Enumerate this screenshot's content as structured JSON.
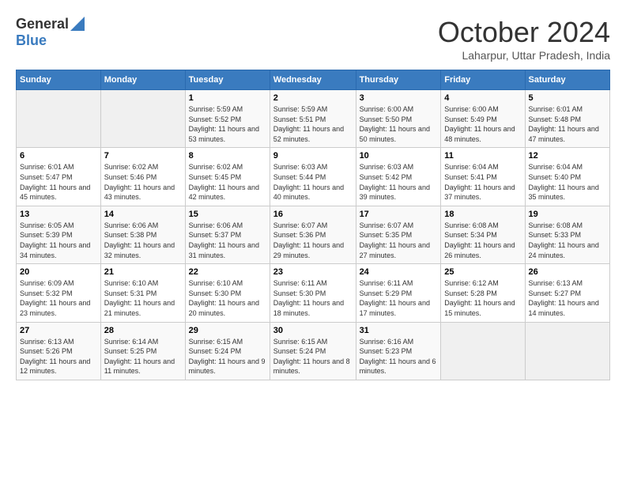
{
  "header": {
    "logo_general": "General",
    "logo_blue": "Blue",
    "month_title": "October 2024",
    "subtitle": "Laharpur, Uttar Pradesh, India"
  },
  "days_of_week": [
    "Sunday",
    "Monday",
    "Tuesday",
    "Wednesday",
    "Thursday",
    "Friday",
    "Saturday"
  ],
  "weeks": [
    [
      {
        "day": "",
        "sunrise": "",
        "sunset": "",
        "daylight": "",
        "empty": true
      },
      {
        "day": "",
        "sunrise": "",
        "sunset": "",
        "daylight": "",
        "empty": true
      },
      {
        "day": "1",
        "sunrise": "Sunrise: 5:59 AM",
        "sunset": "Sunset: 5:52 PM",
        "daylight": "Daylight: 11 hours and 53 minutes.",
        "empty": false
      },
      {
        "day": "2",
        "sunrise": "Sunrise: 5:59 AM",
        "sunset": "Sunset: 5:51 PM",
        "daylight": "Daylight: 11 hours and 52 minutes.",
        "empty": false
      },
      {
        "day": "3",
        "sunrise": "Sunrise: 6:00 AM",
        "sunset": "Sunset: 5:50 PM",
        "daylight": "Daylight: 11 hours and 50 minutes.",
        "empty": false
      },
      {
        "day": "4",
        "sunrise": "Sunrise: 6:00 AM",
        "sunset": "Sunset: 5:49 PM",
        "daylight": "Daylight: 11 hours and 48 minutes.",
        "empty": false
      },
      {
        "day": "5",
        "sunrise": "Sunrise: 6:01 AM",
        "sunset": "Sunset: 5:48 PM",
        "daylight": "Daylight: 11 hours and 47 minutes.",
        "empty": false
      }
    ],
    [
      {
        "day": "6",
        "sunrise": "Sunrise: 6:01 AM",
        "sunset": "Sunset: 5:47 PM",
        "daylight": "Daylight: 11 hours and 45 minutes.",
        "empty": false
      },
      {
        "day": "7",
        "sunrise": "Sunrise: 6:02 AM",
        "sunset": "Sunset: 5:46 PM",
        "daylight": "Daylight: 11 hours and 43 minutes.",
        "empty": false
      },
      {
        "day": "8",
        "sunrise": "Sunrise: 6:02 AM",
        "sunset": "Sunset: 5:45 PM",
        "daylight": "Daylight: 11 hours and 42 minutes.",
        "empty": false
      },
      {
        "day": "9",
        "sunrise": "Sunrise: 6:03 AM",
        "sunset": "Sunset: 5:44 PM",
        "daylight": "Daylight: 11 hours and 40 minutes.",
        "empty": false
      },
      {
        "day": "10",
        "sunrise": "Sunrise: 6:03 AM",
        "sunset": "Sunset: 5:42 PM",
        "daylight": "Daylight: 11 hours and 39 minutes.",
        "empty": false
      },
      {
        "day": "11",
        "sunrise": "Sunrise: 6:04 AM",
        "sunset": "Sunset: 5:41 PM",
        "daylight": "Daylight: 11 hours and 37 minutes.",
        "empty": false
      },
      {
        "day": "12",
        "sunrise": "Sunrise: 6:04 AM",
        "sunset": "Sunset: 5:40 PM",
        "daylight": "Daylight: 11 hours and 35 minutes.",
        "empty": false
      }
    ],
    [
      {
        "day": "13",
        "sunrise": "Sunrise: 6:05 AM",
        "sunset": "Sunset: 5:39 PM",
        "daylight": "Daylight: 11 hours and 34 minutes.",
        "empty": false
      },
      {
        "day": "14",
        "sunrise": "Sunrise: 6:06 AM",
        "sunset": "Sunset: 5:38 PM",
        "daylight": "Daylight: 11 hours and 32 minutes.",
        "empty": false
      },
      {
        "day": "15",
        "sunrise": "Sunrise: 6:06 AM",
        "sunset": "Sunset: 5:37 PM",
        "daylight": "Daylight: 11 hours and 31 minutes.",
        "empty": false
      },
      {
        "day": "16",
        "sunrise": "Sunrise: 6:07 AM",
        "sunset": "Sunset: 5:36 PM",
        "daylight": "Daylight: 11 hours and 29 minutes.",
        "empty": false
      },
      {
        "day": "17",
        "sunrise": "Sunrise: 6:07 AM",
        "sunset": "Sunset: 5:35 PM",
        "daylight": "Daylight: 11 hours and 27 minutes.",
        "empty": false
      },
      {
        "day": "18",
        "sunrise": "Sunrise: 6:08 AM",
        "sunset": "Sunset: 5:34 PM",
        "daylight": "Daylight: 11 hours and 26 minutes.",
        "empty": false
      },
      {
        "day": "19",
        "sunrise": "Sunrise: 6:08 AM",
        "sunset": "Sunset: 5:33 PM",
        "daylight": "Daylight: 11 hours and 24 minutes.",
        "empty": false
      }
    ],
    [
      {
        "day": "20",
        "sunrise": "Sunrise: 6:09 AM",
        "sunset": "Sunset: 5:32 PM",
        "daylight": "Daylight: 11 hours and 23 minutes.",
        "empty": false
      },
      {
        "day": "21",
        "sunrise": "Sunrise: 6:10 AM",
        "sunset": "Sunset: 5:31 PM",
        "daylight": "Daylight: 11 hours and 21 minutes.",
        "empty": false
      },
      {
        "day": "22",
        "sunrise": "Sunrise: 6:10 AM",
        "sunset": "Sunset: 5:30 PM",
        "daylight": "Daylight: 11 hours and 20 minutes.",
        "empty": false
      },
      {
        "day": "23",
        "sunrise": "Sunrise: 6:11 AM",
        "sunset": "Sunset: 5:30 PM",
        "daylight": "Daylight: 11 hours and 18 minutes.",
        "empty": false
      },
      {
        "day": "24",
        "sunrise": "Sunrise: 6:11 AM",
        "sunset": "Sunset: 5:29 PM",
        "daylight": "Daylight: 11 hours and 17 minutes.",
        "empty": false
      },
      {
        "day": "25",
        "sunrise": "Sunrise: 6:12 AM",
        "sunset": "Sunset: 5:28 PM",
        "daylight": "Daylight: 11 hours and 15 minutes.",
        "empty": false
      },
      {
        "day": "26",
        "sunrise": "Sunrise: 6:13 AM",
        "sunset": "Sunset: 5:27 PM",
        "daylight": "Daylight: 11 hours and 14 minutes.",
        "empty": false
      }
    ],
    [
      {
        "day": "27",
        "sunrise": "Sunrise: 6:13 AM",
        "sunset": "Sunset: 5:26 PM",
        "daylight": "Daylight: 11 hours and 12 minutes.",
        "empty": false
      },
      {
        "day": "28",
        "sunrise": "Sunrise: 6:14 AM",
        "sunset": "Sunset: 5:25 PM",
        "daylight": "Daylight: 11 hours and 11 minutes.",
        "empty": false
      },
      {
        "day": "29",
        "sunrise": "Sunrise: 6:15 AM",
        "sunset": "Sunset: 5:24 PM",
        "daylight": "Daylight: 11 hours and 9 minutes.",
        "empty": false
      },
      {
        "day": "30",
        "sunrise": "Sunrise: 6:15 AM",
        "sunset": "Sunset: 5:24 PM",
        "daylight": "Daylight: 11 hours and 8 minutes.",
        "empty": false
      },
      {
        "day": "31",
        "sunrise": "Sunrise: 6:16 AM",
        "sunset": "Sunset: 5:23 PM",
        "daylight": "Daylight: 11 hours and 6 minutes.",
        "empty": false
      },
      {
        "day": "",
        "sunrise": "",
        "sunset": "",
        "daylight": "",
        "empty": true
      },
      {
        "day": "",
        "sunrise": "",
        "sunset": "",
        "daylight": "",
        "empty": true
      }
    ]
  ]
}
